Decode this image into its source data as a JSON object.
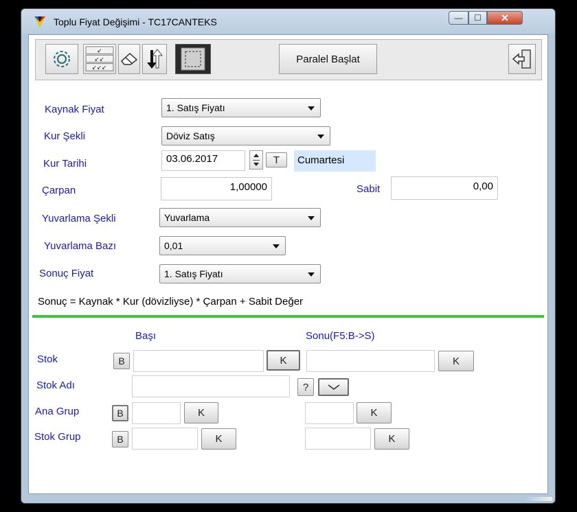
{
  "window": {
    "title": "Toplu Fiyat Değişimi - TC17CANTEKS",
    "controls": {
      "minimize": "—",
      "maximize": "☐",
      "close": "✕"
    }
  },
  "toolbar": {
    "parallel_label": "Paralel Başlat",
    "icons": [
      "gear-icon",
      "multi-edit-icon",
      "eraser-icon",
      "sort-icon",
      "select-area-icon",
      "exit-door-icon"
    ]
  },
  "form": {
    "source_price_label": "Kaynak Fiyat",
    "source_price_value": "1. Satış Fiyatı",
    "rate_type_label": "Kur Şekli",
    "rate_type_value": "Döviz Satış",
    "rate_date_label": "Kur Tarihi",
    "rate_date_value": "03.06.2017",
    "today_button": "T",
    "day_name": "Cumartesi",
    "multiplier_label": "Çarpan",
    "multiplier_value": "1,00000",
    "constant_label": "Sabit",
    "constant_value": "0,00",
    "rounding_type_label": "Yuvarlama Şekli",
    "rounding_type_value": "Yuvarlama",
    "rounding_base_label": "Yuvarlama Bazı",
    "rounding_base_value": "0,01",
    "result_price_label": "Sonuç Fiyat",
    "result_price_value": "1. Satış Fiyatı",
    "formula_text": "Sonuç = Kaynak * Kur (dövizliyse) * Çarpan + Sabit Değer"
  },
  "filters": {
    "start_header": "Başı",
    "end_header": "Sonu(F5:B->S)",
    "stock_label": "Stok",
    "stock_name_label": "Stok Adı",
    "main_group_label": "Ana Grup",
    "stock_group_label": "Stok Grup",
    "b_label": "B",
    "k_label": "K",
    "question_label": "?",
    "accent_color": "#3dc43d"
  }
}
